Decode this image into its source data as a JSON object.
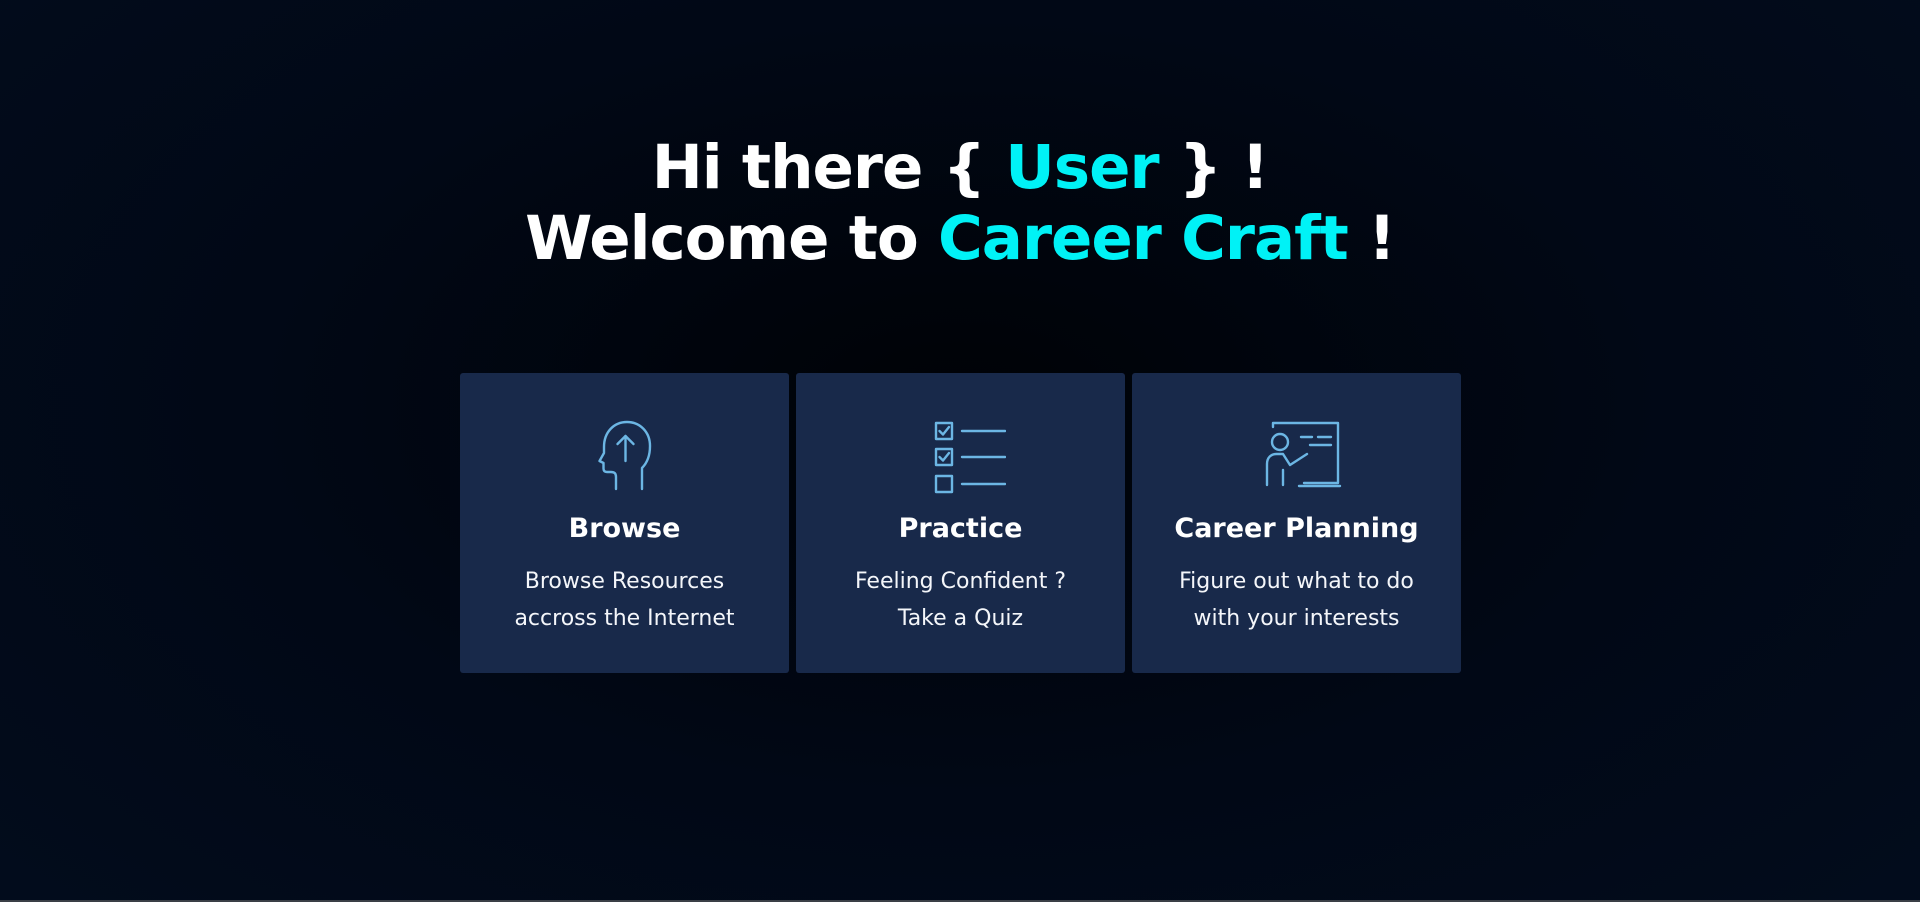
{
  "colors": {
    "background": "#010816",
    "card_background": "#18294a",
    "accent": "#00f2f6",
    "icon_stroke": "#6cb6e4",
    "text": "#ffffff"
  },
  "hero": {
    "line1": {
      "prefix": "Hi there { ",
      "name": "User",
      "suffix": " } !"
    },
    "line2": {
      "prefix": "Welcome to ",
      "brand": "Career Craft",
      "suffix": " !"
    }
  },
  "cards": [
    {
      "icon": "head-arrow-up-icon",
      "title": "Browse",
      "description": [
        "Browse Resources",
        "accross the Internet"
      ]
    },
    {
      "icon": "checklist-icon",
      "title": "Practice",
      "description": [
        "Feeling Confident ?",
        "Take a Quiz"
      ]
    },
    {
      "icon": "presentation-board-icon",
      "title": "Career Planning",
      "description": [
        "Figure out what to do",
        "with your interests"
      ]
    }
  ]
}
